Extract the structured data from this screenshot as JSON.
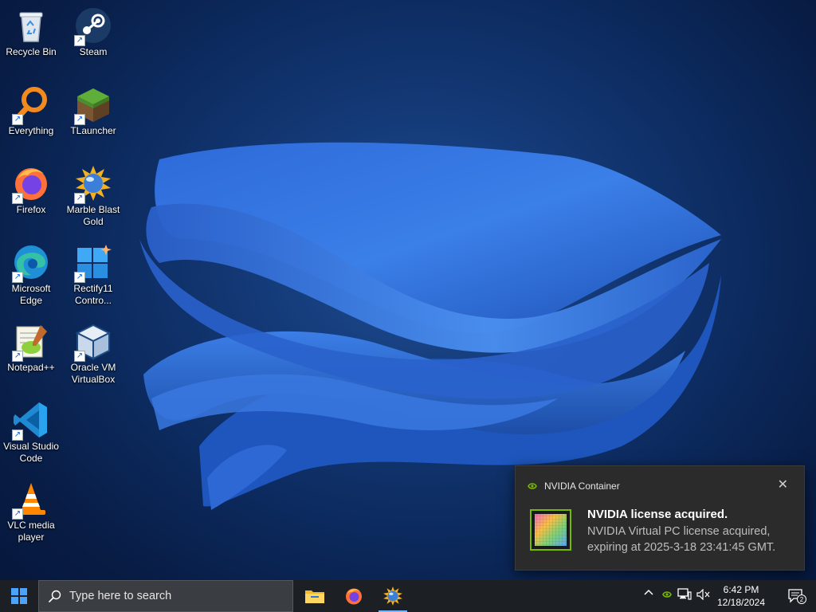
{
  "desktop": {
    "icons": [
      {
        "label": "Recycle Bin",
        "icon": "recycle-bin-icon",
        "shortcut": false
      },
      {
        "label": "Steam",
        "icon": "steam-icon",
        "shortcut": true
      },
      {
        "label": "Everything",
        "icon": "everything-search-icon",
        "shortcut": true
      },
      {
        "label": "TLauncher",
        "icon": "tlauncher-grass-block-icon",
        "shortcut": true
      },
      {
        "label": "Firefox",
        "icon": "firefox-icon",
        "shortcut": true
      },
      {
        "label": "Marble Blast\nGold",
        "icon": "marble-blast-gold-icon",
        "shortcut": true
      },
      {
        "label": "Microsoft\nEdge",
        "icon": "edge-icon",
        "shortcut": true
      },
      {
        "label": "Rectify11\nContro...",
        "icon": "rectify11-icon",
        "shortcut": true
      },
      {
        "label": "Notepad++",
        "icon": "notepad-plus-plus-icon",
        "shortcut": true
      },
      {
        "label": "Oracle VM\nVirtualBox",
        "icon": "virtualbox-icon",
        "shortcut": true
      },
      {
        "label": "Visual Studio\nCode",
        "icon": "vscode-icon",
        "shortcut": true
      },
      {
        "label": "VLC media\nplayer",
        "icon": "vlc-icon",
        "shortcut": true
      }
    ]
  },
  "toast": {
    "app_name": "NVIDIA Container",
    "title": "NVIDIA license acquired.",
    "body": "NVIDIA Virtual PC license acquired, expiring at 2025-3-18 23:41:45 GMT.",
    "close_glyph": "✕"
  },
  "taskbar": {
    "search_placeholder": "Type here to search",
    "pinned": [
      "file-explorer-icon",
      "firefox-icon",
      "marble-blast-gold-icon"
    ],
    "clock_time": "6:42 PM",
    "clock_date": "12/18/2024",
    "notification_count": "2",
    "tray_chevron": "^"
  },
  "colors": {
    "accent": "#76b6ff",
    "nvidia_green": "#76b900",
    "taskbar": "#1c1f24",
    "toast_bg": "#2b2b2b"
  }
}
